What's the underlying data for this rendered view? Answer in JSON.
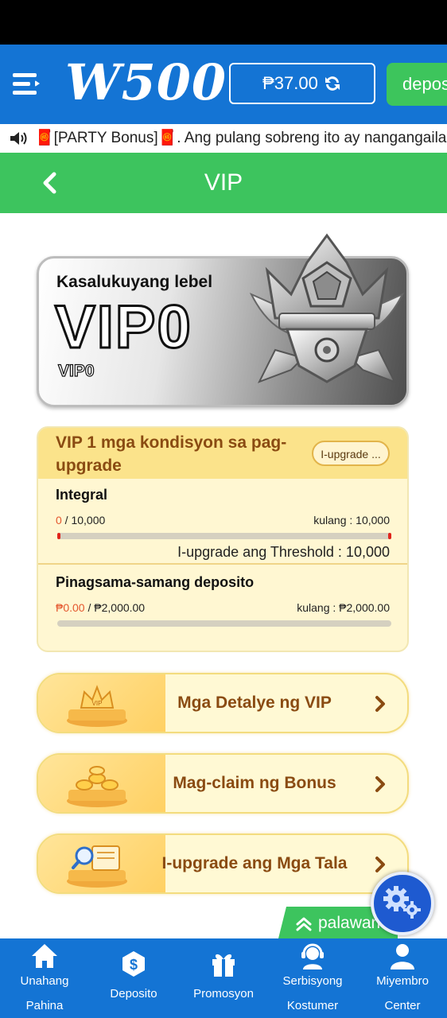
{
  "header": {
    "brand": "W500",
    "balance": "₱37.00",
    "deposit_label": "deposit"
  },
  "marquee": {
    "text": "🧧[PARTY Bonus]🧧. Ang pulang sobreng ito ay nangangailangan"
  },
  "titlebar": {
    "title": "VIP"
  },
  "vip_card": {
    "current_level_label": "Kasalukuyang lebel",
    "level_big": "VIP0",
    "level_small": "VIP0"
  },
  "conditions": {
    "title": "VIP 1 mga kondisyon sa pag-upgrade",
    "upgrade_button": "I-upgrade ...",
    "integral": {
      "label": "Integral",
      "current": "0",
      "target": " / 10,000",
      "remaining": "kulang : 10,000",
      "progress": 0,
      "threshold_label": "I-upgrade ang Threshold :  10,000"
    },
    "deposit": {
      "label": "Pinagsama-samang deposito",
      "current": "₱0.00",
      "target": " / ₱2,000.00",
      "remaining": "kulang : ₱2,000.00",
      "progress": 0
    }
  },
  "menu": {
    "vip_details": "Mga Detalye ng VIP",
    "claim_bonus": "Mag-claim ng Bonus",
    "upgrade_records": "I-upgrade ang Mga Tala"
  },
  "floating": {
    "palawan_label": "palawan"
  },
  "bottom_nav": [
    {
      "line1": "Unahang",
      "line2": "Pahina"
    },
    {
      "line1": "Deposito"
    },
    {
      "line1": "Promosyon"
    },
    {
      "line1": "Serbisyong",
      "line2": "Kostumer"
    },
    {
      "line1": "Miyembro",
      "line2": "Center"
    }
  ],
  "colors": {
    "primary_blue": "#1474d4",
    "green": "#3dc45e",
    "gold_text": "#8a4b12",
    "cream": "#fff7d2"
  }
}
